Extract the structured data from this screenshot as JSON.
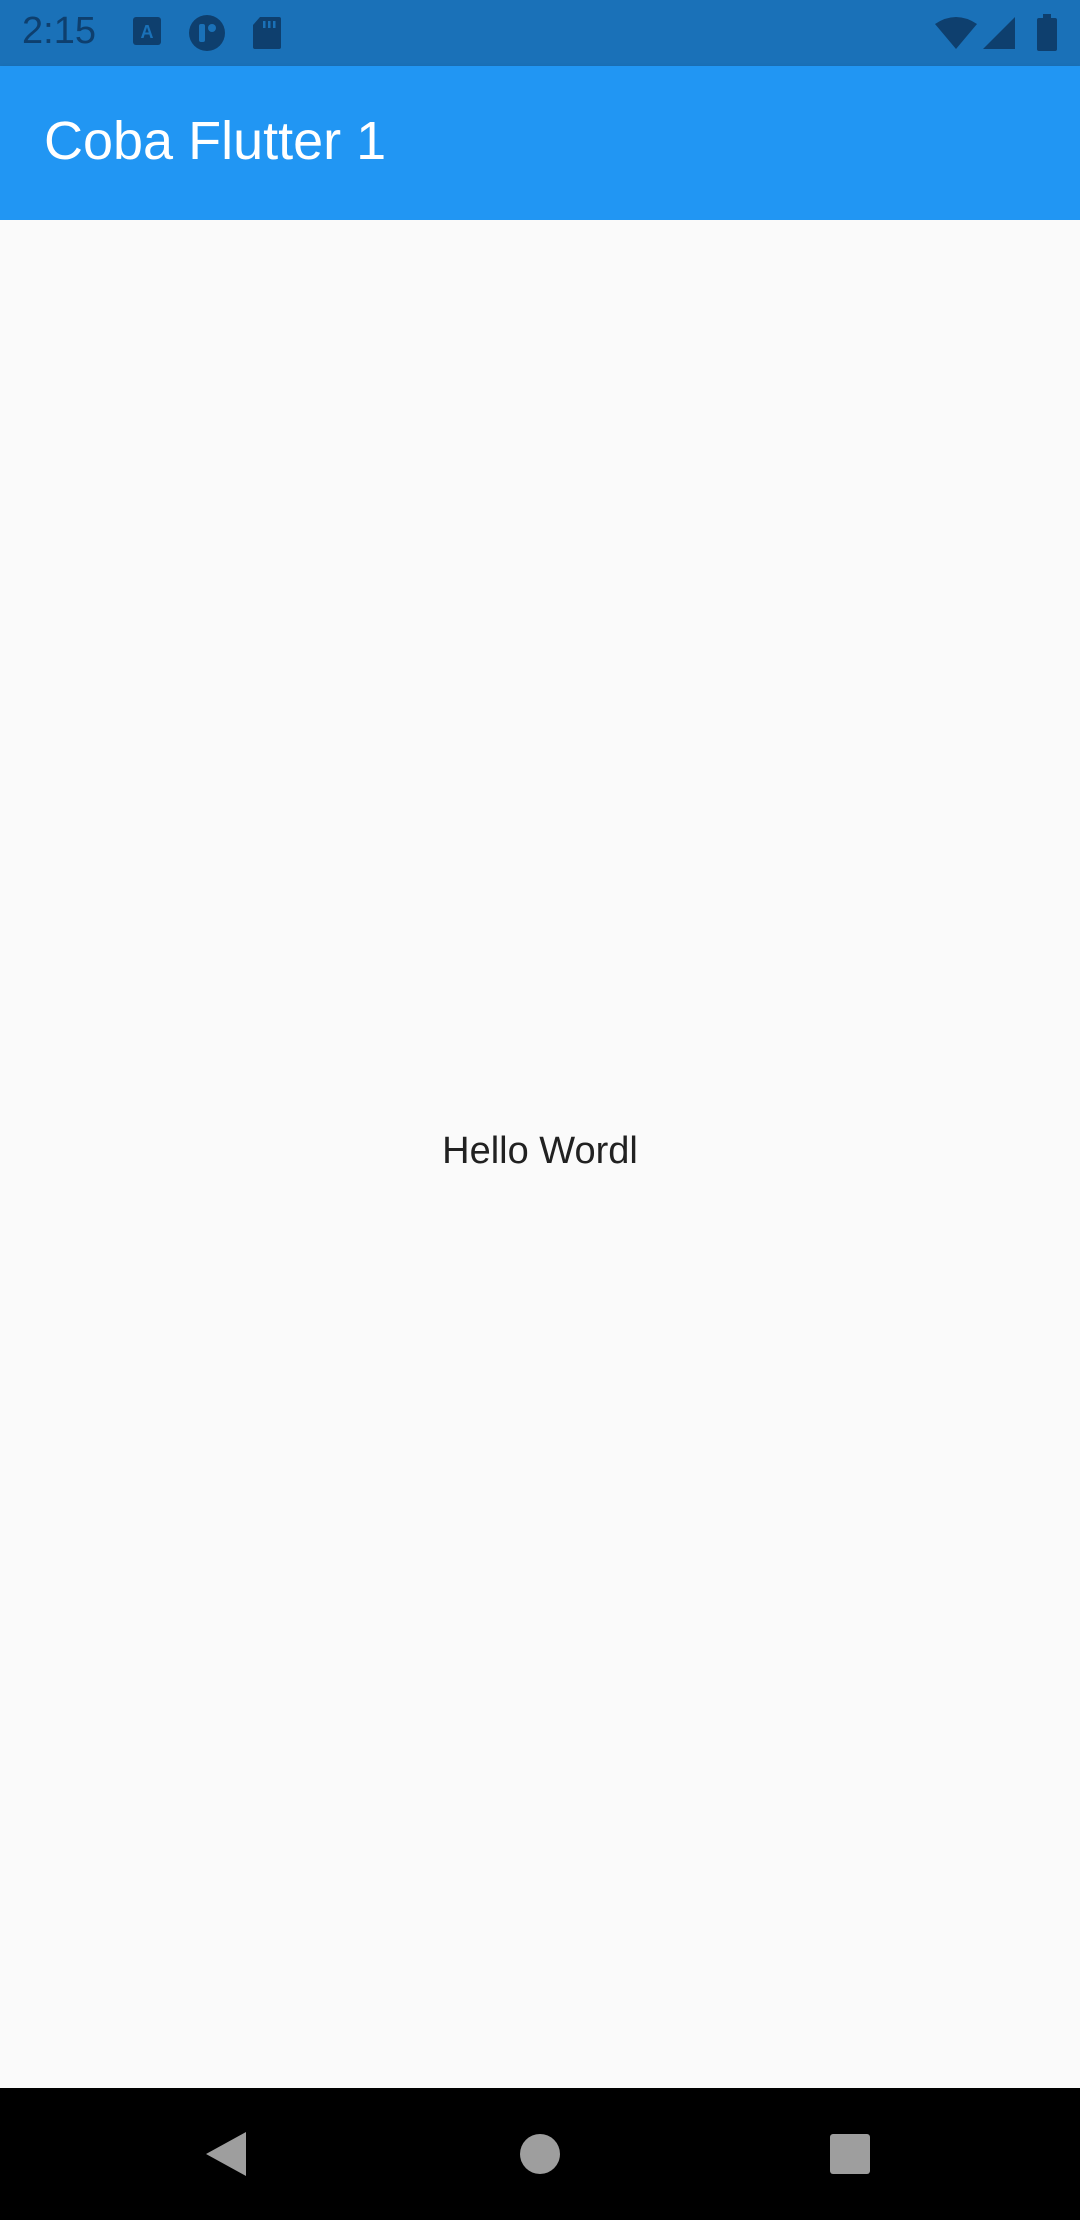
{
  "status_bar": {
    "time": "2:15",
    "icons": [
      "keyboard-a-icon",
      "app-notification-icon",
      "sd-card-icon",
      "wifi-icon",
      "cell-signal-icon",
      "battery-icon"
    ]
  },
  "app_bar": {
    "title": "Coba Flutter 1"
  },
  "main": {
    "text": "Hello Wordl"
  },
  "nav_bar": {
    "buttons": [
      "back-icon",
      "home-icon",
      "recents-icon"
    ]
  },
  "colors": {
    "status_bar": "#1a71b8",
    "app_bar": "#2196f3",
    "background": "#fafafa",
    "nav_bar": "#000000"
  }
}
